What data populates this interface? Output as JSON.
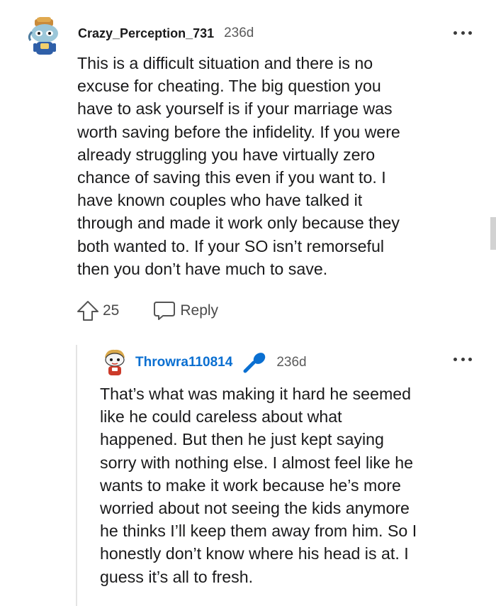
{
  "comment": {
    "username": "Crazy_Perception_731",
    "age": "236d",
    "lines": [
      "This is a difficult situation and there is no",
      "excuse for cheating. The big question you",
      "have to ask yourself is if your marriage was",
      "worth saving before the infidelity. If you were",
      "already struggling you have virtually zero",
      "chance of saving this even if you want to. I",
      "have known couples who have talked it",
      "through and made it work only because they",
      "both wanted to. If your SO isn’t remorseful",
      "then you don’t have much to save."
    ],
    "upvotes": "25",
    "reply_label": "Reply"
  },
  "reply": {
    "username": "Throwra110814",
    "age": "236d",
    "lines": [
      "That’s what was making it hard he seemed",
      "like he could careless about what",
      "happened. But then he just kept saying",
      "sorry with nothing else. I almost feel like he",
      "wants to make it work because he’s more",
      "worried about not seeing the kids anymore",
      "he thinks I’ll keep them away from him. So I",
      "honestly don’t know where his head is at. I",
      "guess it’s all to fresh."
    ]
  },
  "icons": {
    "comment_avatar": "snoo-avatar",
    "reply_avatar": "snoo-avatar",
    "op_badge": "microphone-icon",
    "more": "more-options-icon",
    "upvote": "upvote-arrow-icon",
    "reply": "speech-bubble-icon"
  },
  "colors": {
    "op_username": "#0a6fd1",
    "op_badge": "#0a6fd1",
    "text": "#1a1a1b",
    "muted": "#5b5b5b"
  }
}
